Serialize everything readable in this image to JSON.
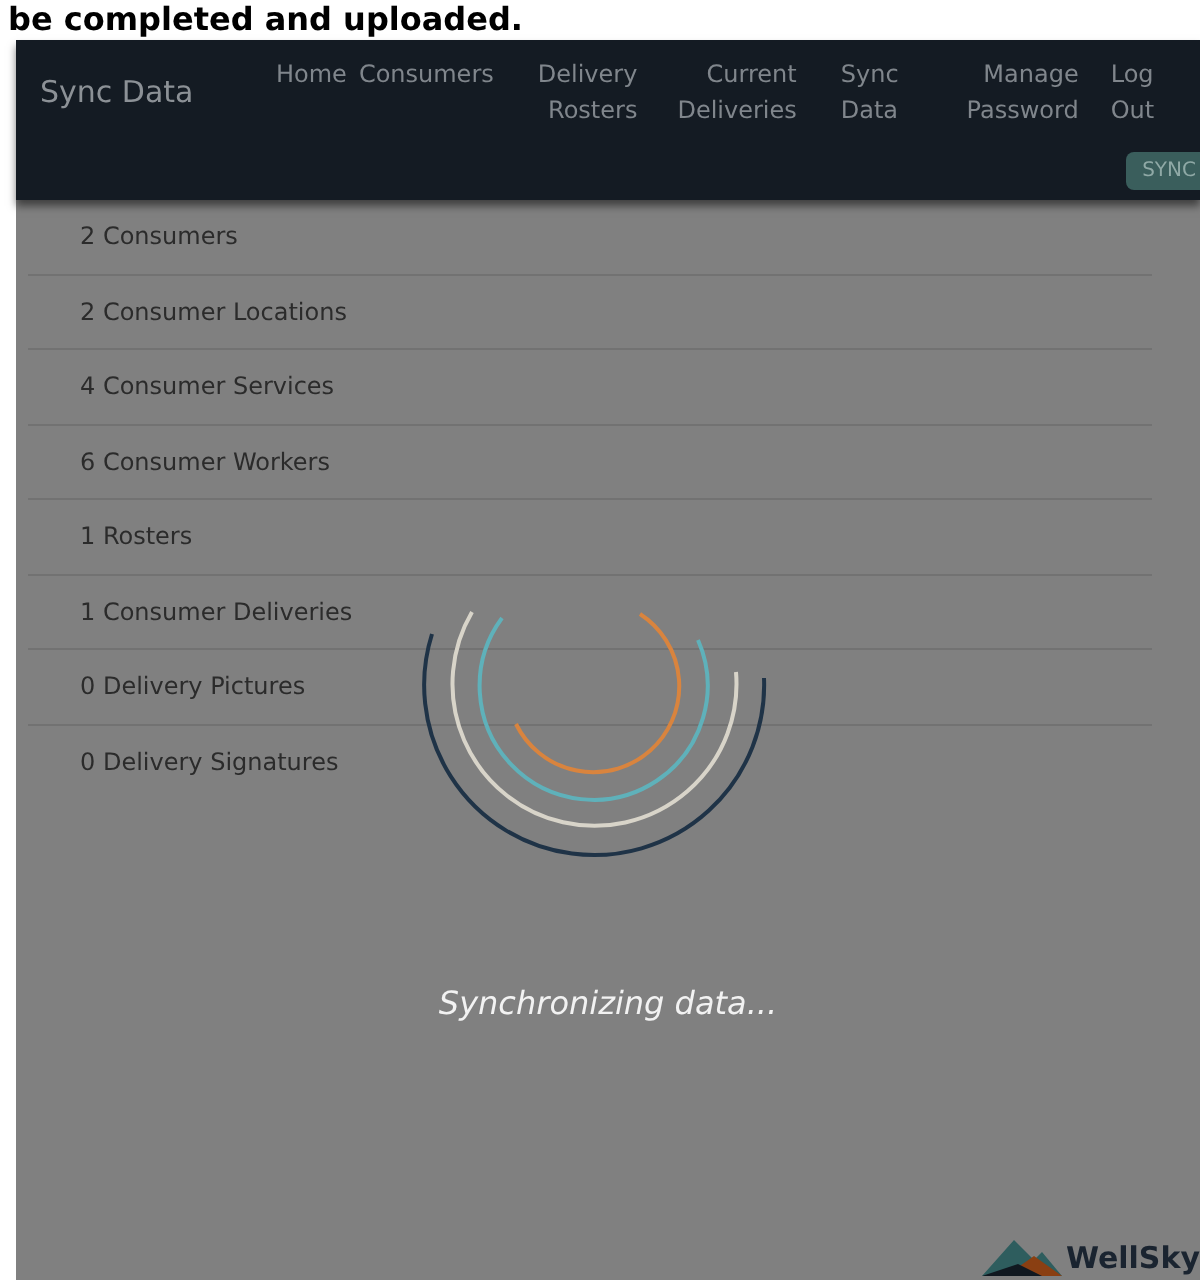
{
  "page_heading": "be completed and uploaded.",
  "navbar": {
    "brand": "Sync Data",
    "items": [
      {
        "label": "Home",
        "selected": false
      },
      {
        "label": "Consumers",
        "selected": false
      },
      {
        "label": "Delivery Rosters",
        "selected": false
      },
      {
        "label": "Current Deliveries",
        "selected": false
      },
      {
        "label": "Sync Data",
        "selected": false
      },
      {
        "label": "Manage Password",
        "selected": false
      },
      {
        "label": "Log Out",
        "selected": false
      }
    ],
    "sync_button": "SYNC"
  },
  "sync_counts": [
    "2 Consumers",
    "2 Consumer Locations",
    "4 Consumer Services",
    "6 Consumer Workers",
    "1 Rosters",
    "1 Consumer Deliveries",
    "0 Delivery Pictures",
    "0 Delivery Signatures"
  ],
  "overlay": {
    "message": "Synchronizing data..."
  },
  "footer": {
    "logo_text": "WellSky"
  }
}
